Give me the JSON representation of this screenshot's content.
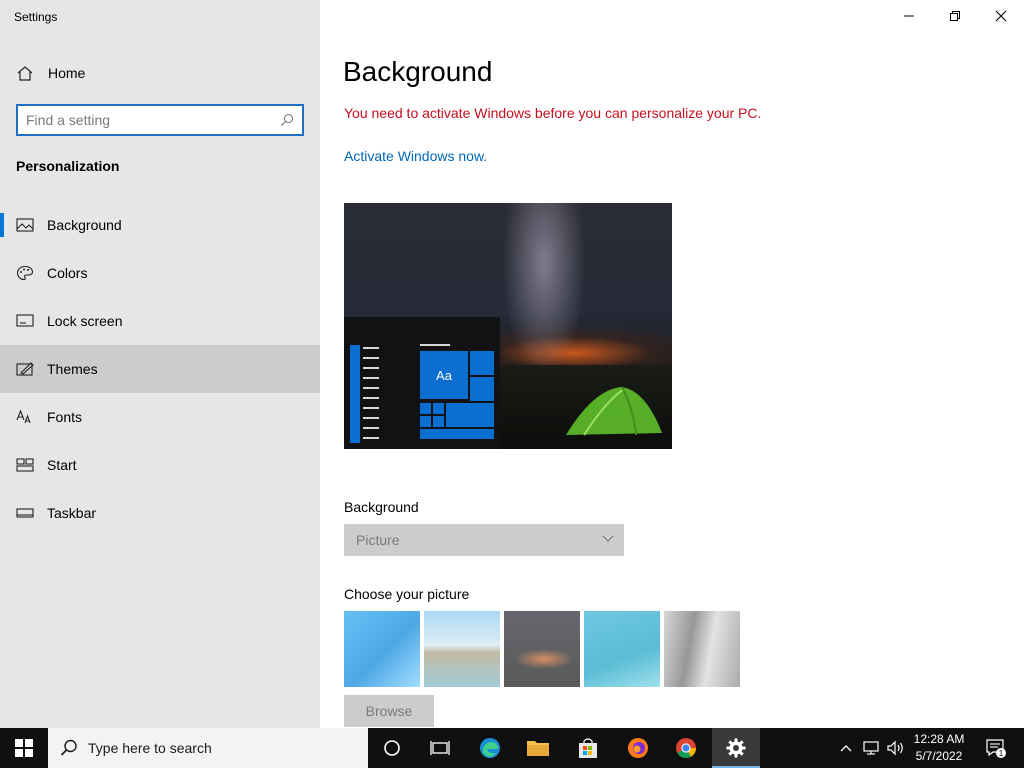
{
  "window": {
    "title": "Settings"
  },
  "sidebar": {
    "home_label": "Home",
    "search_placeholder": "Find a setting",
    "section_title": "Personalization",
    "items": [
      {
        "label": "Background",
        "icon": "picture-icon",
        "state": "selected"
      },
      {
        "label": "Colors",
        "icon": "palette-icon"
      },
      {
        "label": "Lock screen",
        "icon": "lock-screen-icon"
      },
      {
        "label": "Themes",
        "icon": "themes-icon",
        "state": "hover"
      },
      {
        "label": "Fonts",
        "icon": "fonts-icon"
      },
      {
        "label": "Start",
        "icon": "start-icon"
      },
      {
        "label": "Taskbar",
        "icon": "taskbar-icon"
      }
    ]
  },
  "main": {
    "title": "Background",
    "warning": "You need to activate Windows before you can personalize your PC.",
    "activate_link": "Activate Windows now.",
    "preview": {
      "tile_label": "Aa"
    },
    "background_label": "Background",
    "background_dropdown": {
      "selected": "Picture"
    },
    "choose_picture_label": "Choose your picture",
    "browse_label": "Browse"
  },
  "taskbar": {
    "search_placeholder": "Type here to search",
    "time": "12:28 AM",
    "date": "5/7/2022",
    "notification_count": "1"
  },
  "colors": {
    "accent": "#0078d7",
    "warning": "#c50f1f",
    "link": "#0067b8",
    "sidebar_bg": "#e6e6e6"
  }
}
